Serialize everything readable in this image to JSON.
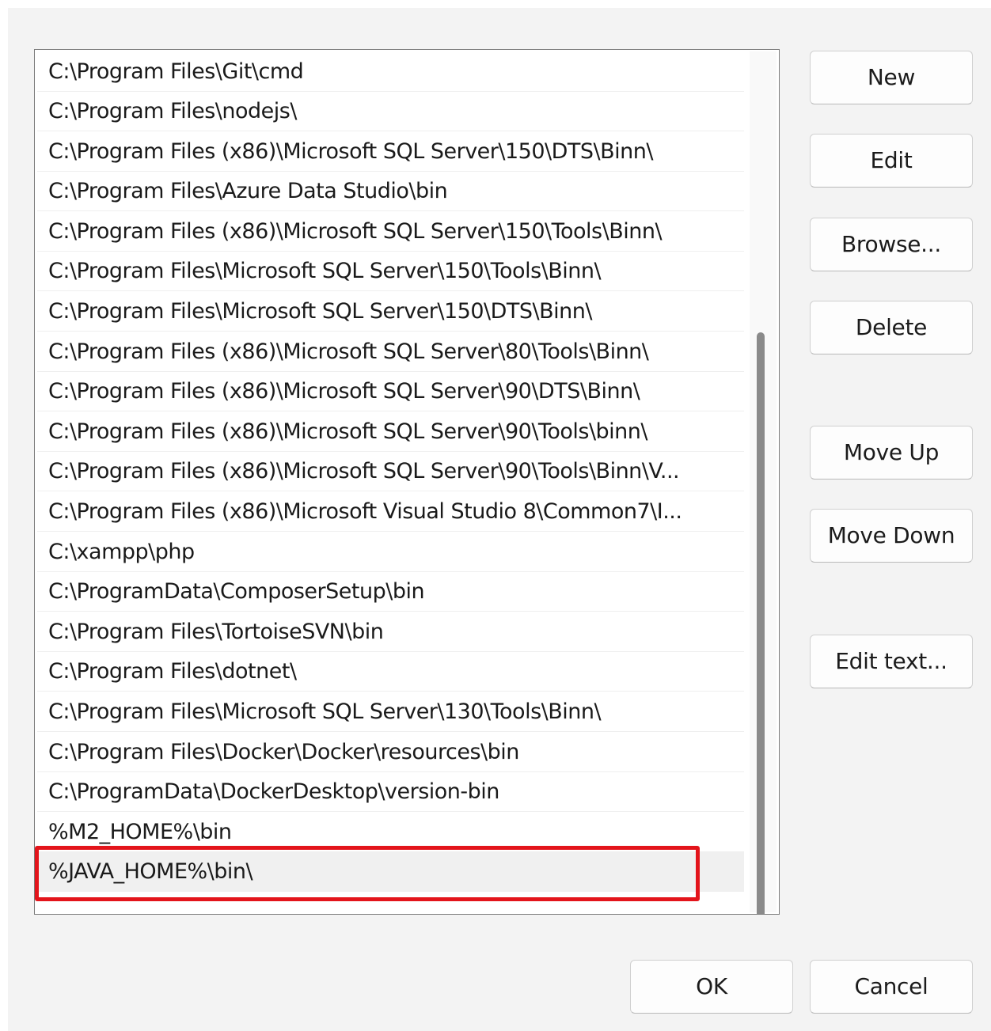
{
  "path_list": {
    "items": [
      "C:\\Program Files\\Git\\cmd",
      "C:\\Program Files\\nodejs\\",
      "C:\\Program Files (x86)\\Microsoft SQL Server\\150\\DTS\\Binn\\",
      "C:\\Program Files\\Azure Data Studio\\bin",
      "C:\\Program Files (x86)\\Microsoft SQL Server\\150\\Tools\\Binn\\",
      "C:\\Program Files\\Microsoft SQL Server\\150\\Tools\\Binn\\",
      "C:\\Program Files\\Microsoft SQL Server\\150\\DTS\\Binn\\",
      "C:\\Program Files (x86)\\Microsoft SQL Server\\80\\Tools\\Binn\\",
      "C:\\Program Files (x86)\\Microsoft SQL Server\\90\\DTS\\Binn\\",
      "C:\\Program Files (x86)\\Microsoft SQL Server\\90\\Tools\\binn\\",
      "C:\\Program Files (x86)\\Microsoft SQL Server\\90\\Tools\\Binn\\V...",
      "C:\\Program Files (x86)\\Microsoft Visual Studio 8\\Common7\\I...",
      "C:\\xampp\\php",
      "C:\\ProgramData\\ComposerSetup\\bin",
      "C:\\Program Files\\TortoiseSVN\\bin",
      "C:\\Program Files\\dotnet\\",
      "C:\\Program Files\\Microsoft SQL Server\\130\\Tools\\Binn\\",
      "C:\\Program Files\\Docker\\Docker\\resources\\bin",
      "C:\\ProgramData\\DockerDesktop\\version-bin",
      "%M2_HOME%\\bin",
      "%JAVA_HOME%\\bin\\"
    ],
    "selected_index": 20
  },
  "buttons": {
    "new": "New",
    "edit": "Edit",
    "browse": "Browse...",
    "delete": "Delete",
    "move_up": "Move Up",
    "move_down": "Move Down",
    "edit_text": "Edit text...",
    "ok": "OK",
    "cancel": "Cancel"
  },
  "colors": {
    "highlight_border": "#e3141b"
  }
}
